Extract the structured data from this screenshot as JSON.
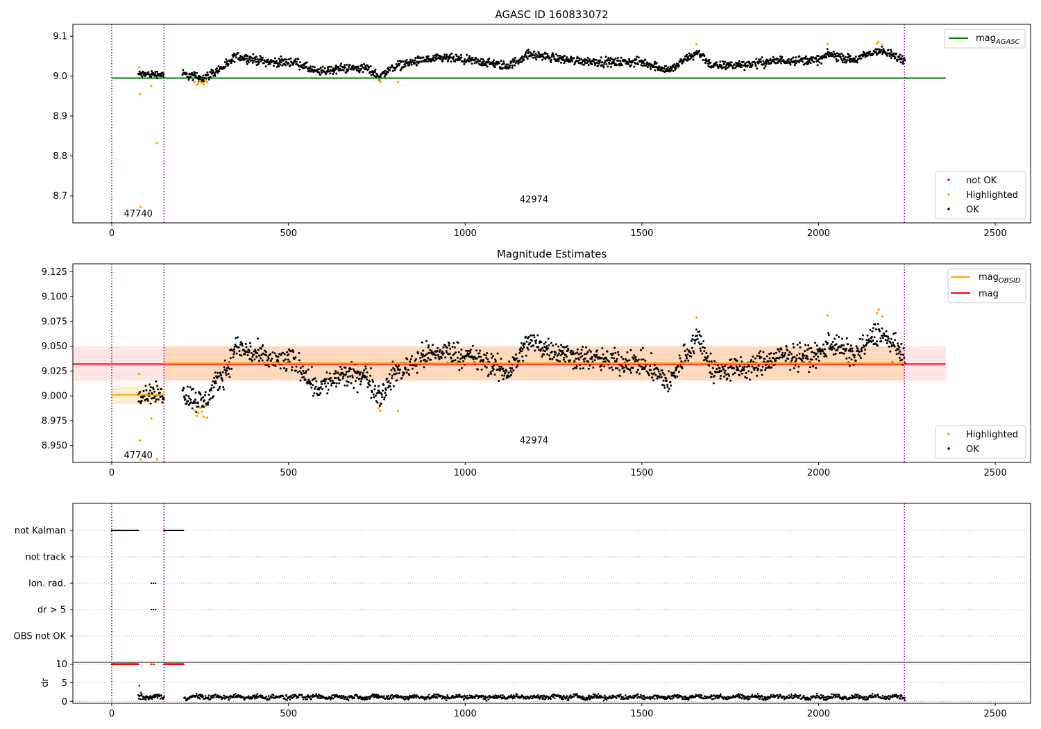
{
  "chart_data": [
    {
      "type": "scatter",
      "title": "AGASC ID 160833072",
      "xlim": [
        -110,
        2600
      ],
      "ylim": [
        8.632,
        9.13
      ],
      "x_ticks": [
        "0",
        "500",
        "1000",
        "1500",
        "2000",
        "2500"
      ],
      "y_ticks": [
        "8.7",
        "8.8",
        "8.9",
        "9.0",
        "9.1"
      ],
      "reference_lines": [
        {
          "name": "mag",
          "subscript": "AGASC",
          "y": 8.995,
          "x_range": [
            0,
            2360
          ],
          "color": "#008000"
        }
      ],
      "obsid_boundaries": [
        0,
        148,
        2243
      ],
      "obsid_labels": [
        {
          "text": "47740",
          "x": 75,
          "y": 8.655
        },
        {
          "text": "42974",
          "x": 1195,
          "y": 8.69
        }
      ],
      "legend_series": [
        "not OK",
        "Highlighted",
        "OK"
      ],
      "series": [
        {
          "name": "OK",
          "color": "#000000",
          "segments": [
            {
              "x": [
                75,
                148
              ],
              "mean": 9.005,
              "spread": 0.008
            },
            {
              "x": [
                200,
                2245
              ],
              "profile": [
                [
                  200,
                  9.005
                ],
                [
                  260,
                  8.995
                ],
                [
                  330,
                  9.03
                ],
                [
                  350,
                  9.05
                ],
                [
                  450,
                  9.035
                ],
                [
                  520,
                  9.035
                ],
                [
                  580,
                  9.01
                ],
                [
                  650,
                  9.02
                ],
                [
                  720,
                  9.02
                ],
                [
                  760,
                  9.0
                ],
                [
                  800,
                  9.025
                ],
                [
                  880,
                  9.04
                ],
                [
                  950,
                  9.045
                ],
                [
                  1050,
                  9.035
                ],
                [
                  1120,
                  9.025
                ],
                [
                  1180,
                  9.055
                ],
                [
                  1300,
                  9.04
                ],
                [
                  1400,
                  9.035
                ],
                [
                  1500,
                  9.035
                ],
                [
                  1580,
                  9.015
                ],
                [
                  1620,
                  9.04
                ],
                [
                  1660,
                  9.06
                ],
                [
                  1700,
                  9.025
                ],
                [
                  1800,
                  9.03
                ],
                [
                  1900,
                  9.04
                ],
                [
                  2000,
                  9.04
                ],
                [
                  2030,
                  9.055
                ],
                [
                  2100,
                  9.04
                ],
                [
                  2170,
                  9.065
                ],
                [
                  2245,
                  9.04
                ]
              ],
              "spread": 0.01
            }
          ]
        },
        {
          "name": "Highlighted",
          "color": "#ffa500",
          "points": [
            [
              78,
              9.022
            ],
            [
              80,
              8.955
            ],
            [
              82,
              8.672
            ],
            [
              112,
              8.975
            ],
            [
              128,
              8.832
            ],
            [
              235,
              8.985
            ],
            [
              240,
              8.978
            ],
            [
              245,
              8.982
            ],
            [
              250,
              8.988
            ],
            [
              255,
              8.983
            ],
            [
              260,
              8.979
            ],
            [
              265,
              8.99
            ],
            [
              270,
              8.985
            ],
            [
              755,
              8.99
            ],
            [
              760,
              8.985
            ],
            [
              810,
              8.985
            ],
            [
              1655,
              9.08
            ],
            [
              2025,
              9.08
            ],
            [
              2165,
              9.082
            ],
            [
              2170,
              9.086
            ],
            [
              2180,
              9.079
            ]
          ]
        }
      ]
    },
    {
      "type": "scatter",
      "title": "Magnitude Estimates",
      "xlim": [
        -110,
        2600
      ],
      "ylim": [
        8.933,
        9.133
      ],
      "x_ticks": [
        "0",
        "500",
        "1000",
        "1500",
        "2000",
        "2500"
      ],
      "y_ticks": [
        "8.950",
        "8.975",
        "9.000",
        "9.025",
        "9.050",
        "9.075",
        "9.100",
        "9.125"
      ],
      "reference_lines": [
        {
          "name": "mag",
          "subscript": "OBSID",
          "y": 9.001,
          "x_range": [
            0,
            148
          ],
          "color": "#ffa500",
          "band": [
            8.992,
            9.01
          ]
        },
        {
          "name": "mag",
          "subscript": "OBSID",
          "y": 9.033,
          "x_range": [
            148,
            2243
          ],
          "color": "#ffa500",
          "band": [
            9.016,
            9.05
          ]
        },
        {
          "name": "mag",
          "subscript": "",
          "y": 9.032,
          "x_range": [
            -110,
            2360
          ],
          "color": "#ff0000",
          "band": [
            9.015,
            9.05
          ]
        }
      ],
      "obsid_boundaries": [
        0,
        148,
        2243
      ],
      "obsid_labels": [
        {
          "text": "47740",
          "x": 75,
          "y": 8.94
        },
        {
          "text": "42974",
          "x": 1195,
          "y": 8.955
        }
      ],
      "legend_series": [
        "Highlighted",
        "OK"
      ],
      "series": [
        {
          "name": "OK",
          "color": "#000000",
          "segments": [
            {
              "x": [
                75,
                148
              ],
              "mean": 9.002,
              "spread": 0.009
            },
            {
              "x": [
                200,
                2245
              ],
              "profile": [
                [
                  200,
                  9.003
                ],
                [
                  260,
                  8.993
                ],
                [
                  330,
                  9.03
                ],
                [
                  350,
                  9.05
                ],
                [
                  450,
                  9.035
                ],
                [
                  520,
                  9.035
                ],
                [
                  580,
                  9.008
                ],
                [
                  650,
                  9.02
                ],
                [
                  720,
                  9.02
                ],
                [
                  760,
                  9.0
                ],
                [
                  800,
                  9.022
                ],
                [
                  880,
                  9.04
                ],
                [
                  950,
                  9.045
                ],
                [
                  1050,
                  9.035
                ],
                [
                  1120,
                  9.023
                ],
                [
                  1180,
                  9.055
                ],
                [
                  1300,
                  9.04
                ],
                [
                  1400,
                  9.035
                ],
                [
                  1500,
                  9.033
                ],
                [
                  1580,
                  9.013
                ],
                [
                  1620,
                  9.04
                ],
                [
                  1660,
                  9.06
                ],
                [
                  1700,
                  9.025
                ],
                [
                  1800,
                  9.028
                ],
                [
                  1900,
                  9.04
                ],
                [
                  2000,
                  9.04
                ],
                [
                  2030,
                  9.055
                ],
                [
                  2100,
                  9.04
                ],
                [
                  2170,
                  9.065
                ],
                [
                  2245,
                  9.038
                ]
              ],
              "spread": 0.011
            }
          ]
        },
        {
          "name": "Highlighted",
          "color": "#ffa500",
          "points": [
            [
              78,
              9.022
            ],
            [
              80,
              8.955
            ],
            [
              82,
              8.936
            ],
            [
              112,
              8.977
            ],
            [
              128,
              8.936
            ],
            [
              235,
              8.985
            ],
            [
              240,
              8.98
            ],
            [
              245,
              8.983
            ],
            [
              250,
              8.988
            ],
            [
              255,
              8.984
            ],
            [
              260,
              8.979
            ],
            [
              265,
              8.99
            ],
            [
              270,
              8.978
            ],
            [
              755,
              8.988
            ],
            [
              760,
              8.985
            ],
            [
              810,
              8.985
            ],
            [
              1655,
              9.079
            ],
            [
              2025,
              9.081
            ],
            [
              2165,
              9.083
            ],
            [
              2170,
              9.087
            ],
            [
              2180,
              9.08
            ]
          ]
        }
      ]
    },
    {
      "type": "scatter",
      "title": "",
      "xlim": [
        -110,
        2600
      ],
      "y_categories": [
        "not Kalman",
        "not track",
        "Ion. rad.",
        "dr > 5",
        "OBS not OK"
      ],
      "obsid_boundaries": [
        0,
        148,
        2243
      ],
      "flags": [
        {
          "category": "not Kalman",
          "x_ranges": [
            [
              0,
              75
            ],
            [
              148,
              205
            ]
          ]
        },
        {
          "category": "Ion. rad.",
          "x_ranges": [
            [
              112,
              125
            ]
          ]
        },
        {
          "category": "dr > 5",
          "x_ranges": [
            [
              112,
              125
            ]
          ]
        }
      ]
    },
    {
      "type": "scatter",
      "title": "",
      "xlim": [
        -110,
        2600
      ],
      "ylim": [
        -0.5,
        10.5
      ],
      "ylabel": "dr",
      "x_ticks": [
        "0",
        "500",
        "1000",
        "1500",
        "2000",
        "2500"
      ],
      "y_ticks": [
        "0",
        "5",
        "10"
      ],
      "obsid_boundaries": [
        0,
        148,
        2243
      ],
      "clipped_points": {
        "y": 10,
        "color": "#ff0000",
        "x_ranges": [
          [
            0,
            75
          ],
          [
            112,
            125
          ],
          [
            148,
            205
          ]
        ]
      },
      "outliers": [
        [
          78,
          4.2
        ],
        [
          82,
          2.4
        ]
      ],
      "dr_series": {
        "x_ranges": [
          [
            75,
            148
          ],
          [
            205,
            2245
          ]
        ],
        "mean": 1.2,
        "spread": 0.5,
        "color": "#000000"
      }
    }
  ]
}
